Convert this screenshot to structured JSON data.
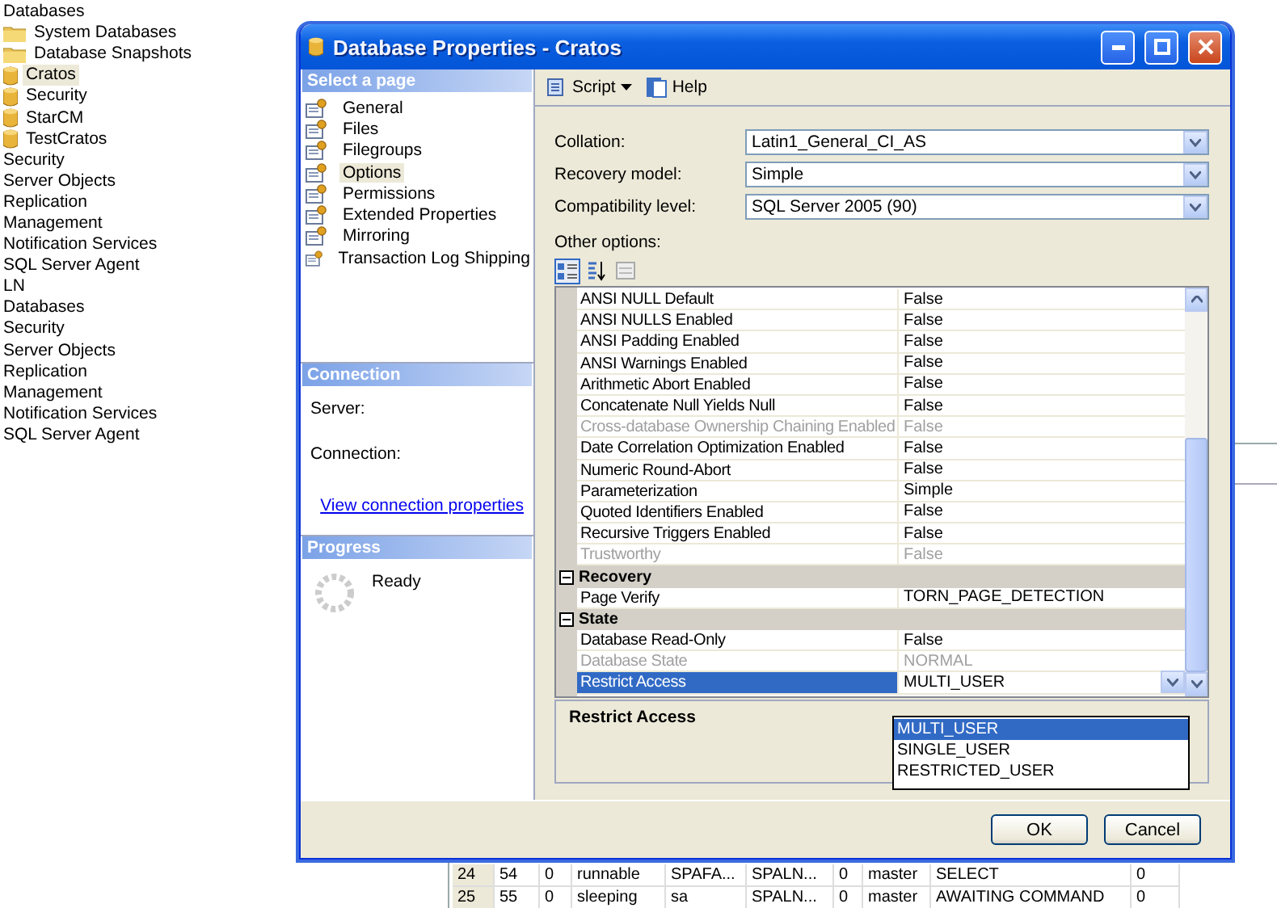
{
  "tree": [
    {
      "label": "Databases",
      "selected": false,
      "children": [
        {
          "label": "System Databases",
          "kind": "folder",
          "selected": false
        },
        {
          "label": "Database Snapshots",
          "kind": "folder",
          "selected": false
        },
        {
          "label": "Cratos",
          "kind": "database",
          "selected": true
        },
        {
          "label": "Security",
          "kind": "database",
          "selected": false
        },
        {
          "label": "StarCM",
          "kind": "database",
          "selected": false
        },
        {
          "label": "TestCratos",
          "kind": "database",
          "selected": false
        }
      ]
    },
    {
      "label": "Security",
      "selected": false
    },
    {
      "label": "Server Objects",
      "selected": false
    },
    {
      "label": "Replication",
      "selected": false
    },
    {
      "label": "Management",
      "selected": false
    },
    {
      "label": "Notification Services",
      "selected": false
    },
    {
      "label": "SQL Server Agent",
      "selected": false
    },
    {
      "label": "LN",
      "selected": false
    },
    {
      "label": "Databases",
      "selected": false
    },
    {
      "label": "Security",
      "selected": false
    },
    {
      "label": "Server Objects",
      "selected": false
    },
    {
      "label": "Replication",
      "selected": false
    },
    {
      "label": "Management",
      "selected": false
    },
    {
      "label": "Notification Services",
      "selected": false
    },
    {
      "label": "SQL Server Agent",
      "selected": false
    }
  ],
  "background_grid": {
    "rows": [
      [
        "24",
        "54",
        "0",
        "runnable",
        "SPAFA...",
        "SPALN...",
        "0",
        "master",
        "SELECT",
        "0"
      ],
      [
        "25",
        "55",
        "0",
        "sleeping",
        "sa",
        "SPALN...",
        "0",
        "master",
        "AWAITING COMMAND",
        "0"
      ]
    ]
  },
  "dialog": {
    "title": "Database Properties - Cratos",
    "select_page": {
      "title": "Select a page",
      "pages": [
        {
          "label": "General",
          "selected": false
        },
        {
          "label": "Files",
          "selected": false
        },
        {
          "label": "Filegroups",
          "selected": false
        },
        {
          "label": "Options",
          "selected": true
        },
        {
          "label": "Permissions",
          "selected": false
        },
        {
          "label": "Extended Properties",
          "selected": false
        },
        {
          "label": "Mirroring",
          "selected": false
        },
        {
          "label": "Transaction Log Shipping",
          "selected": false
        }
      ]
    },
    "connection": {
      "title": "Connection",
      "server_label": "Server:",
      "connection_label": "Connection:",
      "link": "View connection properties"
    },
    "progress": {
      "title": "Progress",
      "status": "Ready"
    },
    "toolbar": {
      "script": "Script",
      "help": "Help"
    },
    "fields": [
      {
        "label": "Collation:",
        "value": "Latin1_General_CI_AS"
      },
      {
        "label": "Recovery model:",
        "value": "Simple"
      },
      {
        "label": "Compatibility level:",
        "value": "SQL Server 2005 (90)"
      }
    ],
    "other_options_label": "Other options:",
    "properties": [
      {
        "kind": "property",
        "name": "ANSI NULL Default",
        "value": "False",
        "disabled": false,
        "selected": false
      },
      {
        "kind": "property",
        "name": "ANSI NULLS Enabled",
        "value": "False",
        "disabled": false,
        "selected": false
      },
      {
        "kind": "property",
        "name": "ANSI Padding Enabled",
        "value": "False",
        "disabled": false,
        "selected": false
      },
      {
        "kind": "property",
        "name": "ANSI Warnings Enabled",
        "value": "False",
        "disabled": false,
        "selected": false
      },
      {
        "kind": "property",
        "name": "Arithmetic Abort Enabled",
        "value": "False",
        "disabled": false,
        "selected": false
      },
      {
        "kind": "property",
        "name": "Concatenate Null Yields Null",
        "value": "False",
        "disabled": false,
        "selected": false
      },
      {
        "kind": "property",
        "name": "Cross-database Ownership Chaining Enabled",
        "value": "False",
        "disabled": true,
        "selected": false
      },
      {
        "kind": "property",
        "name": "Date Correlation Optimization Enabled",
        "value": "False",
        "disabled": false,
        "selected": false
      },
      {
        "kind": "property",
        "name": "Numeric Round-Abort",
        "value": "False",
        "disabled": false,
        "selected": false
      },
      {
        "kind": "property",
        "name": "Parameterization",
        "value": "Simple",
        "disabled": false,
        "selected": false
      },
      {
        "kind": "property",
        "name": "Quoted Identifiers Enabled",
        "value": "False",
        "disabled": false,
        "selected": false
      },
      {
        "kind": "property",
        "name": "Recursive Triggers Enabled",
        "value": "False",
        "disabled": false,
        "selected": false
      },
      {
        "kind": "property",
        "name": "Trustworthy",
        "value": "False",
        "disabled": true,
        "selected": false
      },
      {
        "kind": "category",
        "name": "Recovery",
        "expanded": true
      },
      {
        "kind": "property",
        "name": "Page Verify",
        "value": "TORN_PAGE_DETECTION",
        "disabled": false,
        "selected": false
      },
      {
        "kind": "category",
        "name": "State",
        "expanded": true
      },
      {
        "kind": "property",
        "name": "Database Read-Only",
        "value": "False",
        "disabled": false,
        "selected": false
      },
      {
        "kind": "property",
        "name": "Database State",
        "value": "NORMAL",
        "disabled": true,
        "selected": false
      },
      {
        "kind": "property",
        "name": "Restrict Access",
        "value": "MULTI_USER",
        "disabled": false,
        "selected": true
      }
    ],
    "dropdown_options": [
      {
        "label": "MULTI_USER",
        "selected": true
      },
      {
        "label": "SINGLE_USER",
        "selected": false
      },
      {
        "label": "RESTRICTED_USER",
        "selected": false
      }
    ],
    "description_title": "Restrict Access",
    "buttons": [
      "OK",
      "Cancel"
    ]
  }
}
